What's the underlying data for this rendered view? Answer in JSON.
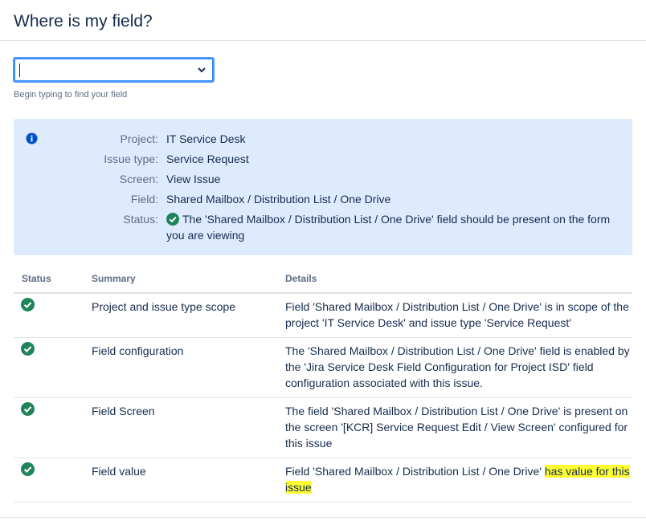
{
  "header": {
    "title": "Where is my field?"
  },
  "field_select": {
    "value": "",
    "hint": "Begin typing to find your field"
  },
  "info_panel": {
    "icon": "info-icon",
    "rows": [
      {
        "key": "Project:",
        "value": "IT Service Desk"
      },
      {
        "key": "Issue type:",
        "value": "Service Request"
      },
      {
        "key": "Screen:",
        "value": "View Issue"
      },
      {
        "key": "Field:",
        "value": "Shared Mailbox / Distribution List / One Drive"
      },
      {
        "key": "Status:",
        "value": "The 'Shared Mailbox / Distribution List / One Drive' field should be present on the form you are viewing",
        "icon": "check-circle-icon"
      }
    ]
  },
  "results": {
    "columns": [
      "Status",
      "Summary",
      "Details"
    ],
    "rows": [
      {
        "status_icon": "check-circle-icon",
        "summary": "Project and issue type scope",
        "details": "Field 'Shared Mailbox / Distribution List / One Drive' is in scope of the project 'IT Service Desk' and issue type 'Service Request'"
      },
      {
        "status_icon": "check-circle-icon",
        "summary": "Field configuration",
        "details": "The 'Shared Mailbox / Distribution List / One Drive' field is enabled by the 'Jira Service Desk Field Configuration for Project ISD' field configuration associated with this issue."
      },
      {
        "status_icon": "check-circle-icon",
        "summary": "Field Screen",
        "details": "The field 'Shared Mailbox / Distribution List / One Drive' is present on the screen '[KCR] Service Request Edit / View Screen' configured for this issue"
      },
      {
        "status_icon": "check-circle-icon",
        "summary": "Field value",
        "details_prefix": "Field 'Shared Mailbox / Distribution List / One Drive' ",
        "details_highlight": "has value for this issue"
      }
    ]
  },
  "colors": {
    "success": "#1f845a",
    "info": "#0052cc",
    "panel_bg": "#deebff",
    "highlight": "#ffff33"
  }
}
